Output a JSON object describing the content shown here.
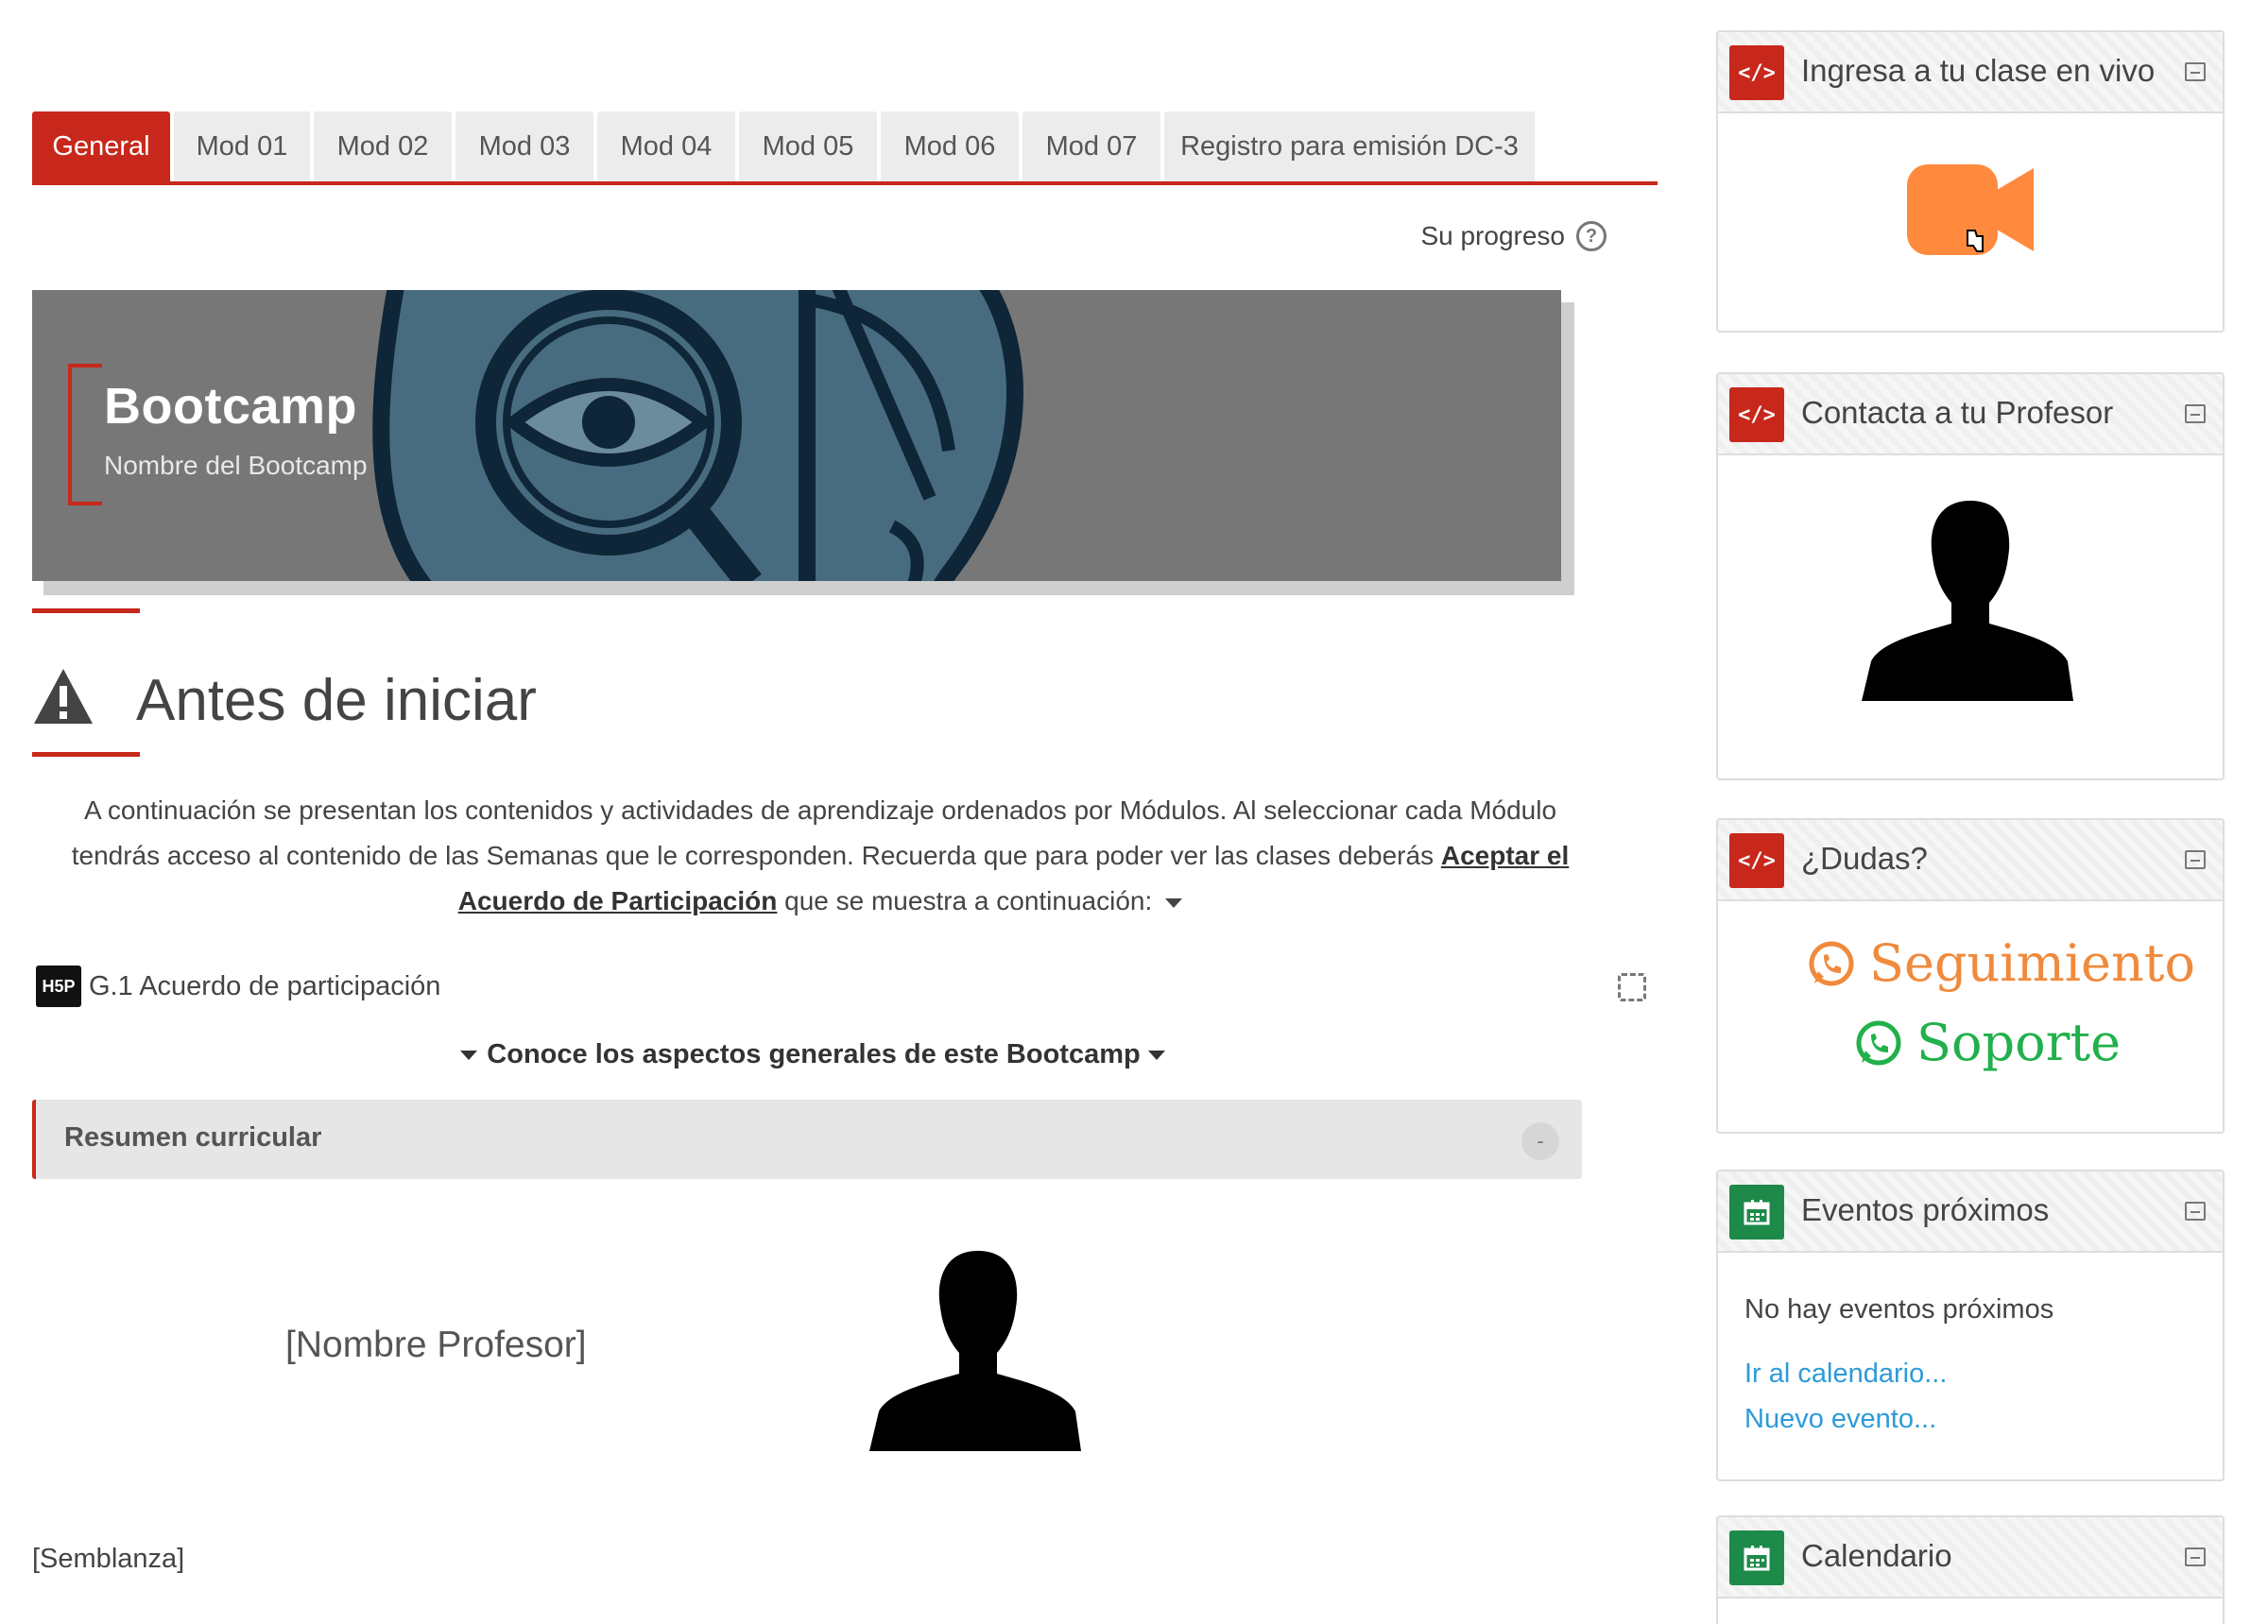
{
  "tabs": [
    {
      "label": "General",
      "active": true
    },
    {
      "label": "Mod 01"
    },
    {
      "label": "Mod 02"
    },
    {
      "label": "Mod 03"
    },
    {
      "label": "Mod 04"
    },
    {
      "label": "Mod 05"
    },
    {
      "label": "Mod 06"
    },
    {
      "label": "Mod 07"
    },
    {
      "label": "Registro para emisión DC-3"
    }
  ],
  "progress": {
    "label": "Su progreso",
    "icon": "help-icon"
  },
  "banner": {
    "title": "Bootcamp",
    "subtitle": "Nombre del Bootcamp"
  },
  "section": {
    "title": "Antes de iniciar",
    "icon": "warning-icon"
  },
  "intro": {
    "text_a": "A continuación se presentan los contenidos y actividades de aprendizaje ordenados por Módulos. Al seleccionar cada Módulo tendrás acceso al contenido de las Semanas que le corresponden. Recuerda que para poder ver las clases deberás ",
    "link": "Aceptar el Acuerdo de Participación",
    "text_b": " que se muestra a continuación:"
  },
  "activity": {
    "logo": "H5P",
    "label": "G.1 Acuerdo de participación"
  },
  "know_more": "Conoce los aspectos generales de este Bootcamp",
  "accordion": {
    "title": "Resumen curricular",
    "toggle": "-"
  },
  "professor": {
    "name": "[Nombre Profesor]",
    "bio": "[Semblanza]"
  },
  "sidebar": {
    "live": {
      "title": "Ingresa a tu clase en vivo",
      "icon_text": "</>"
    },
    "contact": {
      "title": "Contacta a tu Profesor",
      "icon_text": "</>"
    },
    "dudas": {
      "title": "¿Dudas?",
      "icon_text": "</>",
      "seguimiento": "Seguimiento",
      "soporte": "Soporte",
      "seguimiento_color": "#f08a3c",
      "soporte_color": "#22b04b"
    },
    "events": {
      "title": "Eventos próximos",
      "empty": "No hay eventos próximos",
      "link_calendar": "Ir al calendario...",
      "link_new": "Nuevo evento..."
    },
    "calendar": {
      "title": "Calendario"
    }
  },
  "colors": {
    "accent": "#c8281b",
    "link": "#2c9bd8",
    "green_icon": "#1e8a4a",
    "camera": "#ff8a3d"
  }
}
